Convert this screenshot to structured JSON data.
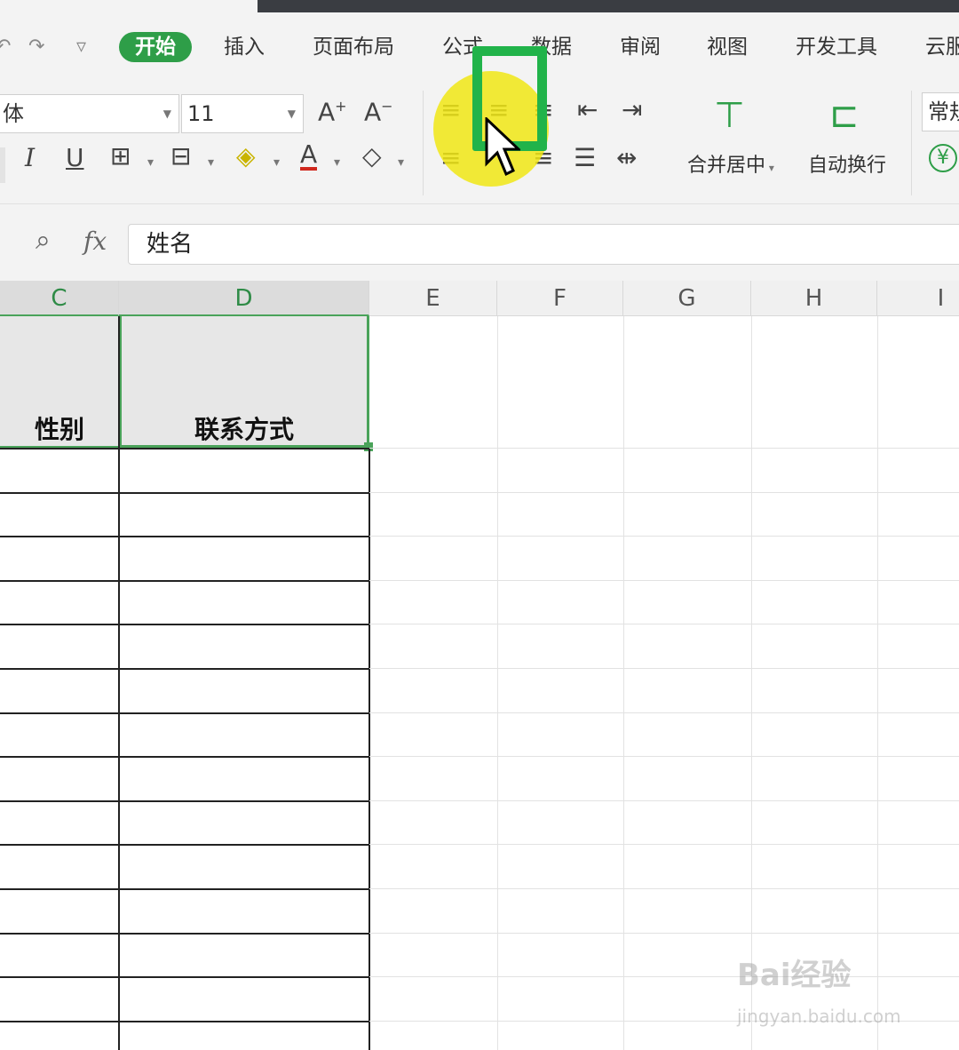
{
  "menu": {
    "tabs": [
      "开始",
      "插入",
      "页面布局",
      "公式",
      "数据",
      "审阅",
      "视图",
      "开发工具",
      "云服"
    ],
    "active_tab": "开始"
  },
  "ribbon": {
    "font_name": "体",
    "font_size": "11",
    "merge_center": "合并居中",
    "wrap_text": "自动换行",
    "number_format": "常规",
    "currency_symbol": "¥"
  },
  "formula_bar": {
    "fx_label": "fx",
    "value": "姓名"
  },
  "grid": {
    "columns": [
      "C",
      "D",
      "E",
      "F",
      "G",
      "H",
      "I"
    ],
    "header_cells": [
      "性别",
      "联系方式"
    ]
  },
  "watermark": {
    "brand": "Bai经验",
    "url": "jingyan.baidu.com"
  },
  "colors": {
    "accent": "#2e9e48",
    "highlight": "#f0e614",
    "focus_box": "#21b34a"
  }
}
